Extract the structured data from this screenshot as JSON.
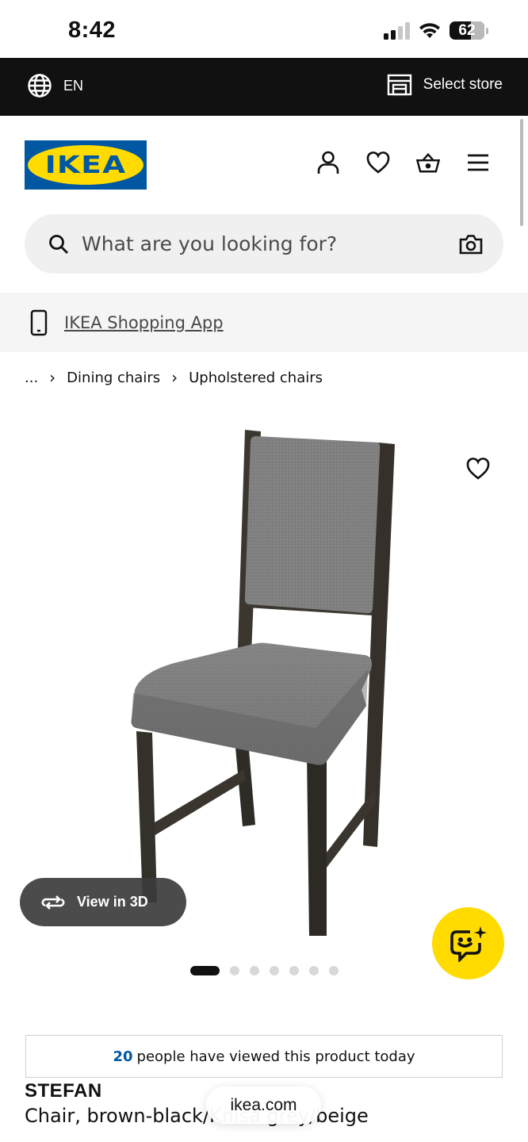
{
  "status_bar": {
    "time": "8:42",
    "battery": "62"
  },
  "top_bar": {
    "language": "EN",
    "store_label": "Select store"
  },
  "header": {
    "logo_text": "IKEA"
  },
  "search": {
    "placeholder": "What are you looking for?"
  },
  "app_banner": {
    "label": "IKEA Shopping App"
  },
  "breadcrumb": {
    "ellipsis": "...",
    "items": [
      "Dining chairs",
      "Upholstered chairs"
    ]
  },
  "gallery": {
    "view_3d_label": "View in 3D",
    "total_images": 7,
    "active_index": 0
  },
  "views_notice": {
    "count": "20",
    "text": "people have viewed this product today"
  },
  "product": {
    "name": "STEFAN",
    "description": "Chair, brown-black/Knisa grey/beige"
  },
  "browser": {
    "url": "ikea.com"
  },
  "colors": {
    "ikea_blue": "#0058a3",
    "ikea_yellow": "#ffdb00",
    "top_bar": "#111111"
  }
}
